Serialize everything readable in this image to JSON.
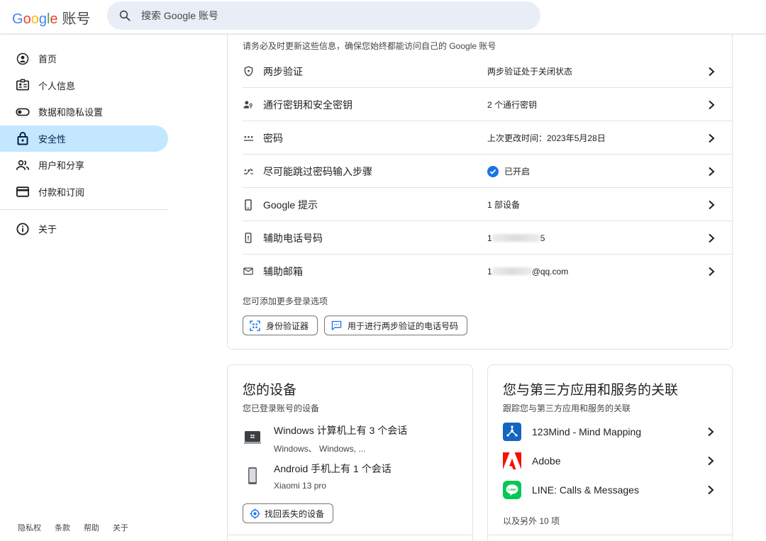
{
  "header": {
    "logo_letters": [
      "G",
      "o",
      "o",
      "g",
      "l",
      "e"
    ],
    "logo_account": "账号",
    "search_placeholder": "搜索 Google 账号"
  },
  "sidebar": {
    "items": [
      {
        "label": "首页",
        "icon": "home-icon"
      },
      {
        "label": "个人信息",
        "icon": "id-card-icon"
      },
      {
        "label": "数据和隐私设置",
        "icon": "toggle-icon"
      },
      {
        "label": "安全性",
        "icon": "lock-icon",
        "active": true
      },
      {
        "label": "用户和分享",
        "icon": "people-icon"
      },
      {
        "label": "付款和订阅",
        "icon": "credit-card-icon"
      }
    ],
    "about": {
      "label": "关于",
      "icon": "info-icon"
    },
    "footer": [
      "隐私权",
      "条款",
      "帮助",
      "关于"
    ]
  },
  "signin": {
    "intro": "请务必及时更新这些信息，确保您始终都能访问自己的 Google 账号",
    "rows": [
      {
        "label": "两步验证",
        "value": "两步验证处于关闭状态",
        "icon": "shield-icon"
      },
      {
        "label": "通行密钥和安全密钥",
        "value": "2 个通行密钥",
        "icon": "passkey-icon"
      },
      {
        "label": "密码",
        "value": "上次更改时间：2023年5月28日",
        "icon": "password-dots-icon"
      },
      {
        "label": "尽可能跳过密码输入步骤",
        "value": "已开启",
        "icon": "skip-password-icon",
        "checked": true
      },
      {
        "label": "Google 提示",
        "value": "1 部设备",
        "icon": "phone-icon"
      },
      {
        "label": "辅助电话号码",
        "value_prefix": "1",
        "value_suffix": "5",
        "icon": "phone-sms-icon"
      },
      {
        "label": "辅助邮箱",
        "value_prefix": "1",
        "value_suffix": "@qq.com",
        "icon": "mail-icon"
      }
    ],
    "more_label": "您可添加更多登录选项",
    "chips": [
      {
        "label": "身份验证器",
        "icon": "authenticator-icon"
      },
      {
        "label": "用于进行两步验证的电话号码",
        "icon": "message-icon"
      }
    ]
  },
  "devices": {
    "title": "您的设备",
    "subtitle": "您已登录账号的设备",
    "items": [
      {
        "title": "Windows 计算机上有 3 个会话",
        "sub": "Windows、 Windows, ...",
        "icon": "laptop-icon"
      },
      {
        "title": "Android 手机上有 1 个会话",
        "sub": "Xiaomi 13 pro",
        "icon": "android-phone-icon"
      }
    ],
    "find_button": "找回丢失的设备"
  },
  "apps": {
    "title": "您与第三方应用和服务的关联",
    "subtitle": "跟踪您与第三方应用和服务的关联",
    "items": [
      {
        "label": "123Mind - Mind Mapping",
        "icon": "mindmap-app-icon",
        "color": "#1565c0"
      },
      {
        "label": "Adobe",
        "icon": "adobe-app-icon",
        "color": "#fa0f00"
      },
      {
        "label": "LINE: Calls & Messages",
        "icon": "line-app-icon",
        "color": "#06c755"
      }
    ],
    "more": "以及另外 10 项"
  },
  "colors": {
    "active_nav_bg": "#c2e7ff",
    "search_bg": "#e9eef6",
    "check_blue": "#1a73e8"
  }
}
